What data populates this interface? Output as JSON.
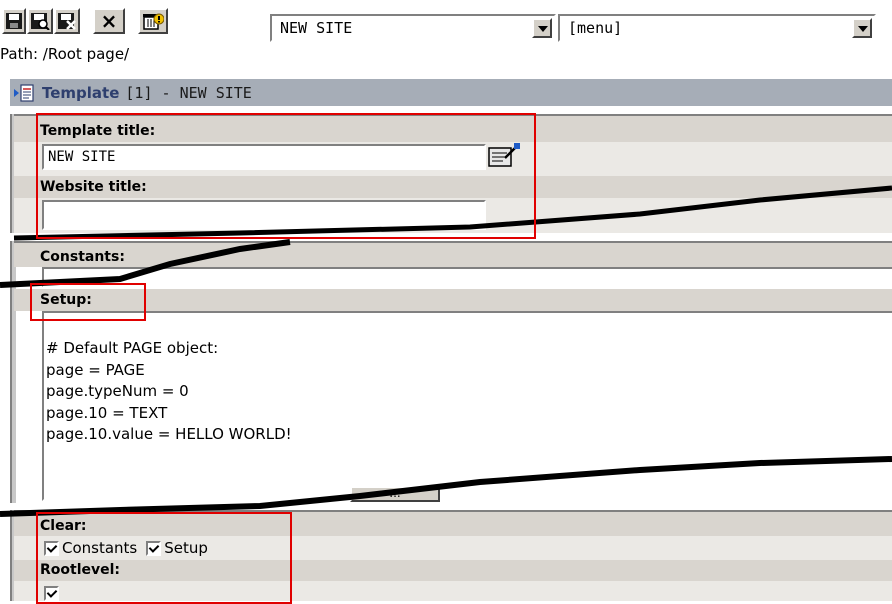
{
  "toolbar": {
    "save_icon": "save-icon",
    "save_view_icon": "save-view-icon",
    "save_close_icon": "save-close-icon",
    "close_label": "×",
    "delete_icon": "delete-icon"
  },
  "site_select": {
    "value": "NEW SITE"
  },
  "menu_select": {
    "value": "[menu]"
  },
  "path": {
    "text": "Path: /Root page/"
  },
  "header": {
    "template_link": "Template",
    "rest": "[1] - NEW SITE"
  },
  "form": {
    "template_title_label": "Template title:",
    "template_title_value": "NEW SITE",
    "website_title_label": "Website title:",
    "website_title_value": "",
    "constants_label": "Constants:",
    "setup_label": "Setup:",
    "setup_code": "# Default PAGE object:\npage = PAGE\npage.typeNum = 0\npage.10 = TEXT\npage.10.value = HELLO WORLD!",
    "resize_dots": "...",
    "clear_label": "Clear:",
    "clear_constants": "Constants",
    "clear_setup": "Setup",
    "rootlevel_label": "Rootlevel:"
  },
  "colors": {
    "header_bar": "#a6adb7",
    "label_row": "#d9d5cf",
    "highlight": "#e00000"
  }
}
